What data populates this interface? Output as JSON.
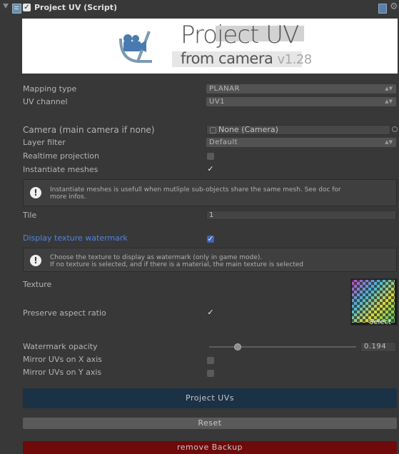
{
  "header": {
    "title": "Project UV (Script)"
  },
  "logo": {
    "line1": "Project UV",
    "line2": "from camera",
    "version": "v1.28"
  },
  "fields": {
    "mapping_type": {
      "label": "Mapping type",
      "value": "PLANAR"
    },
    "uv_channel": {
      "label": "UV channel",
      "value": "UV1"
    },
    "camera": {
      "label": "Camera (main camera if none)",
      "value": "None (Camera)"
    },
    "layer_filter": {
      "label": "Layer filter",
      "value": "Default"
    },
    "realtime_projection": {
      "label": "Realtime projection",
      "checked": false
    },
    "instantiate_meshes": {
      "label": "Instantiate meshes",
      "checked": true
    },
    "tile": {
      "label": "Tile",
      "value": "1"
    },
    "display_watermark": {
      "label": "Display texture watermark",
      "checked": true
    },
    "texture": {
      "label": "Texture",
      "select_label": "Select"
    },
    "preserve_aspect": {
      "label": "Preserve aspect ratio",
      "checked": true
    },
    "watermark_opacity": {
      "label": "Watermark opacity",
      "value": "0.194",
      "fraction": 0.194
    },
    "mirror_x": {
      "label": "Mirror UVs on X axis",
      "checked": false
    },
    "mirror_y": {
      "label": "Mirror UVs on Y axis",
      "checked": false
    }
  },
  "help": {
    "instantiate": {
      "line1": "Instantiate meshes is usefull when mutliple sub-objects share the same mesh. See doc for",
      "line2": "more infos."
    },
    "watermark": {
      "line1": "Choose the texture to display as watermark (only in game mode).",
      "line2": "If no texture is selected, and if there is a material, the main texture is selected"
    }
  },
  "buttons": {
    "project": "Project UVs",
    "reset": "Reset",
    "remove_backup": "remove Backup"
  },
  "colors": {
    "accent_blue": "#4f84e2",
    "project_button": "#1a3146",
    "remove_button": "#6e0a0a"
  },
  "icons": [
    "foldout-arrow-icon",
    "script-icon",
    "help-book-icon",
    "gear-icon",
    "info-icon",
    "object-picker-icon",
    "dropdown-arrow-icon"
  ]
}
